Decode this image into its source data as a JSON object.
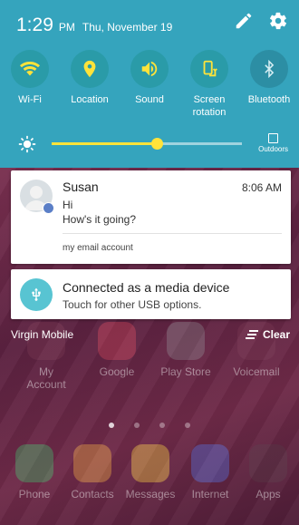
{
  "status_bar": {
    "time": "1:29",
    "ampm": "PM",
    "date": "Thu, November 19"
  },
  "quick_settings": [
    {
      "label": "Wi-Fi",
      "icon": "wifi-icon"
    },
    {
      "label": "Location",
      "icon": "location-icon"
    },
    {
      "label": "Sound",
      "icon": "sound-icon"
    },
    {
      "label": "Screen rotation",
      "icon": "screen-rotation-icon"
    },
    {
      "label": "Bluetooth",
      "icon": "bluetooth-icon"
    }
  ],
  "brightness": {
    "level": 0.55,
    "outdoors_label": "Outdoors"
  },
  "notifications": [
    {
      "sender": "Susan",
      "time": "8:06 AM",
      "line1": "Hi",
      "line2": "How's it going?",
      "account": "my email account"
    },
    {
      "title": "Connected as a media device",
      "subtitle": "Touch for other USB options."
    }
  ],
  "footer": {
    "carrier": "Virgin Mobile",
    "clear_label": "Clear"
  },
  "home_apps": [
    {
      "label": "My Account"
    },
    {
      "label": "Google"
    },
    {
      "label": "Play Store"
    },
    {
      "label": "Voicemail"
    },
    {
      "label": "Phone"
    },
    {
      "label": "Contacts"
    },
    {
      "label": "Messages"
    },
    {
      "label": "Internet"
    },
    {
      "label": "Apps"
    }
  ],
  "colors": {
    "panel": "#35a4bd",
    "accent": "#ffe33a"
  }
}
